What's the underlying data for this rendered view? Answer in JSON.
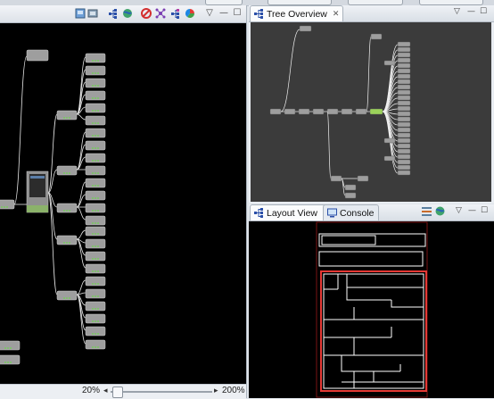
{
  "left_panel": {
    "toolbar_icons": [
      "view-icon",
      "layers-icon",
      "tree-icon",
      "globe-icon",
      "stop-icon",
      "hierarchy-icon",
      "tree-expand-icon",
      "pie-icon",
      "chevron-down-icon",
      "minimize-icon",
      "maximize-icon"
    ],
    "zoom": {
      "min_label": "20%",
      "max_label": "200%",
      "level": 0.02
    }
  },
  "tree_overview": {
    "tab_label": "Tree Overview",
    "tab_icon": "tree-icon",
    "controls": [
      "chevron-down-icon",
      "minimize-icon",
      "maximize-icon"
    ]
  },
  "layout_view": {
    "tab_label": "Layout View",
    "tab_icon": "tree-icon",
    "controls": [
      "layers-icon",
      "globe-icon",
      "chevron-down-icon",
      "minimize-icon",
      "maximize-icon"
    ]
  },
  "console": {
    "tab_label": "Console",
    "tab_icon": "monitor-icon"
  },
  "colors": {
    "canvas": "#000000",
    "overview_bg": "#3b3b3b",
    "node": "#9e9e9e",
    "selected_node": "#9bd25a",
    "layout_highlight": "#e53935"
  }
}
